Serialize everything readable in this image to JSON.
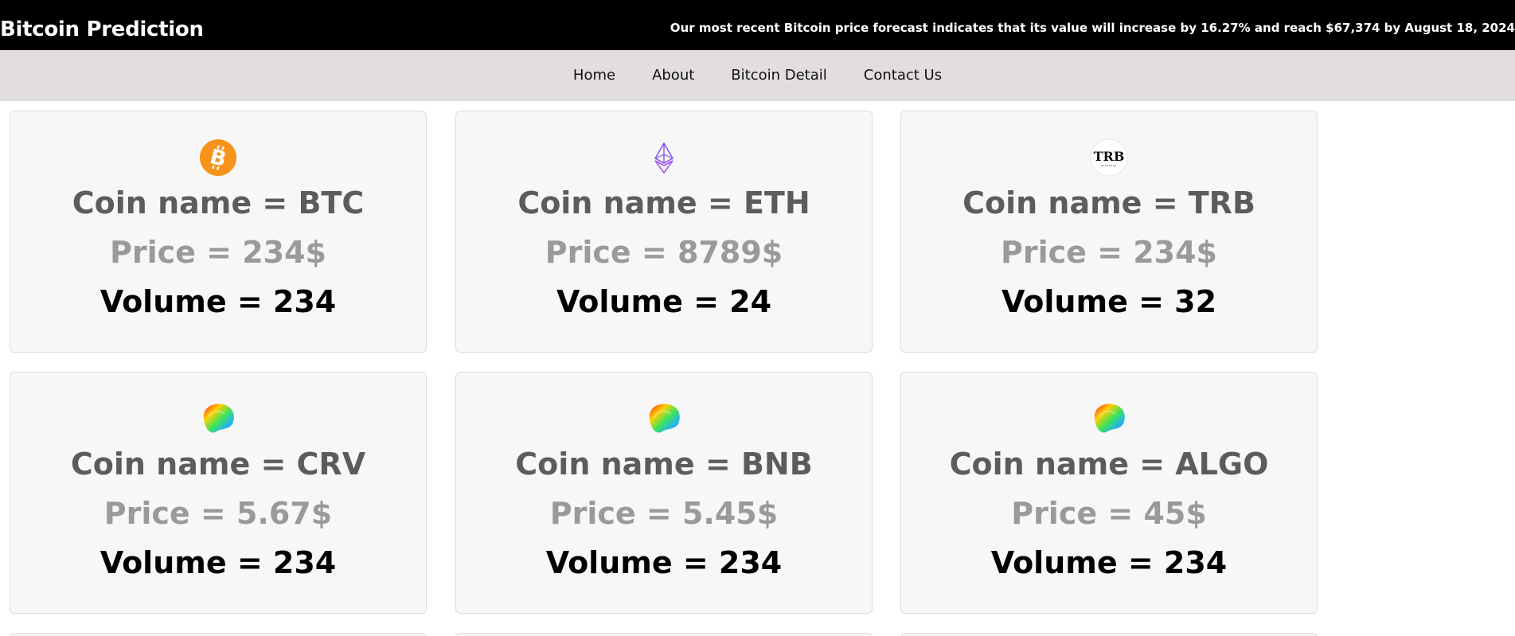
{
  "header": {
    "brand": "Bitcoin Prediction",
    "ticker": "Our most recent Bitcoin price forecast indicates that its value will increase by 16.27% and reach $67,374 by August 18, 2024"
  },
  "nav": {
    "items": [
      {
        "label": "Home"
      },
      {
        "label": "About"
      },
      {
        "label": "Bitcoin Detail"
      },
      {
        "label": "Contact Us"
      }
    ]
  },
  "coins": [
    {
      "name": "Coin name = BTC",
      "price": "Price = 234$",
      "volume": "Volume = 234",
      "icon": "bitcoin-icon"
    },
    {
      "name": "Coin name = ETH",
      "price": "Price = 8789$",
      "volume": "Volume = 24",
      "icon": "ethereum-icon"
    },
    {
      "name": "Coin name = TRB",
      "price": "Price = 234$",
      "volume": "Volume = 32",
      "icon": "trb-logo-icon",
      "icon_text": "TRB"
    },
    {
      "name": "Coin name = CRV",
      "price": "Price = 5.67$",
      "volume": "Volume = 234",
      "icon": "curve-icon"
    },
    {
      "name": "Coin name = BNB",
      "price": "Price = 5.45$",
      "volume": "Volume = 234",
      "icon": "curve-icon"
    },
    {
      "name": "Coin name = ALGO",
      "price": "Price = 45$",
      "volume": "Volume = 234",
      "icon": "curve-icon"
    }
  ],
  "colors": {
    "header_bg": "#000000",
    "nav_bg": "#e3dede",
    "card_bg": "#f7f7f7",
    "coin_name": "#5c5c5c",
    "price": "#9a9a9a",
    "volume": "#000000",
    "bitcoin_orange": "#f7931a"
  }
}
